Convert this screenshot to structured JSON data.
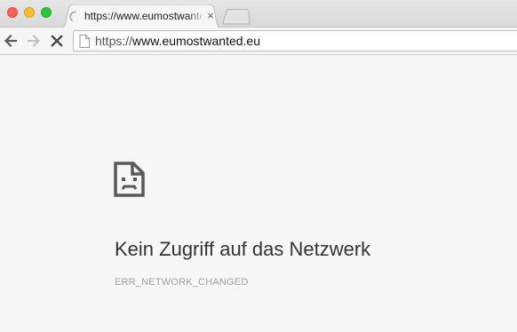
{
  "window": {
    "traffic_lights": [
      "close",
      "minimize",
      "maximize"
    ]
  },
  "tabs": [
    {
      "title": "https://www.eumostwanted.eu",
      "status_icon": "loading-spinner-icon",
      "close_glyph": "×"
    }
  ],
  "new_tab": {
    "icon": "new-tab-icon"
  },
  "toolbar": {
    "back_icon": "back-arrow-icon",
    "forward_icon": "forward-arrow-icon",
    "stop_icon": "stop-x-icon"
  },
  "omnibox": {
    "page_icon": "page-document-icon",
    "scheme": "https://",
    "host": "www.eumostwanted.eu"
  },
  "error_page": {
    "icon": "sad-document-icon",
    "heading": "Kein Zugriff auf das Netzwerk",
    "code": "ERR_NETWORK_CHANGED"
  },
  "colors": {
    "page_background": "#f7f7f7",
    "heading": "#333333",
    "error_code": "#a0a0a0",
    "traffic_close": "#fc5f57",
    "traffic_minimize": "#fdbc2e",
    "traffic_maximize": "#28c840"
  }
}
